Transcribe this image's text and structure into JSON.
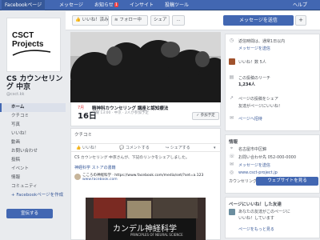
{
  "topbar": {
    "items": [
      "Facebookページ",
      "メッセージ",
      "お知らせ",
      "インサイト",
      "投稿ツール",
      "ヘルプ"
    ],
    "notification_count": "1"
  },
  "actionbar": {
    "buttons": [
      "いいね！済み",
      "フォロー中",
      "シェア",
      "..."
    ],
    "message_button": "メッセージを送信",
    "plus": "+"
  },
  "left": {
    "logo_lines": [
      "CSCT",
      "Projects"
    ],
    "page_name": "CS カウンセリング 中京",
    "page_handle": "@csct.kk",
    "nav": [
      "ホーム",
      "クチコミ",
      "写真",
      "いいね！",
      "動画",
      "お問い合わせ",
      "投稿",
      "イベント",
      "情報",
      "コミュニティ"
    ],
    "create_page": "+ Facebookページを作成",
    "promote": "宣伝する"
  },
  "event": {
    "month": "7月",
    "day": "16日",
    "title": "精神科カウンセリング 講座と認知療法",
    "sub": "日曜 13:00 · 中京 · 2人が参加予定",
    "button": "参加予定"
  },
  "post": {
    "label": "クチコミ",
    "actions": [
      "いいね！",
      "コメントする",
      "シェアする"
    ],
    "note": "CS カウンセリング 中京さんが、下記のリンクをシェアしました。",
    "note2": "神経科学 ストアの書籍",
    "shared_title": "こころの神経科学 · https://www.facebook.com/media/set/?set=a.123",
    "shared_sub": "www.facebook.com",
    "book_title": "カンデル神経科学",
    "book_sub": "PRINCIPLES OF NEURAL SCIENCE"
  },
  "right": {
    "top": [
      "返信時間は、通常1日以内",
      "メッセージを送信",
      "いいね！数 5人",
      "この投稿のリーチ",
      "1,234人",
      "ページの投稿をシェア",
      "友達がページにいいね！",
      "ページへ招待"
    ],
    "info_title": "情報",
    "info_lines": [
      "名古屋市中区錦",
      "お問い合わせ先 052-000-0000",
      "メッセージを送信",
      "www.csct-project.jp",
      "カウンセリング"
    ],
    "send_button": "ウェブサイトを見る",
    "friends_title": "ページにいいね！した友達",
    "friends_lines": [
      "あなたの友達がこのページに",
      "いいね！しています",
      "ページをもっと見る"
    ]
  }
}
